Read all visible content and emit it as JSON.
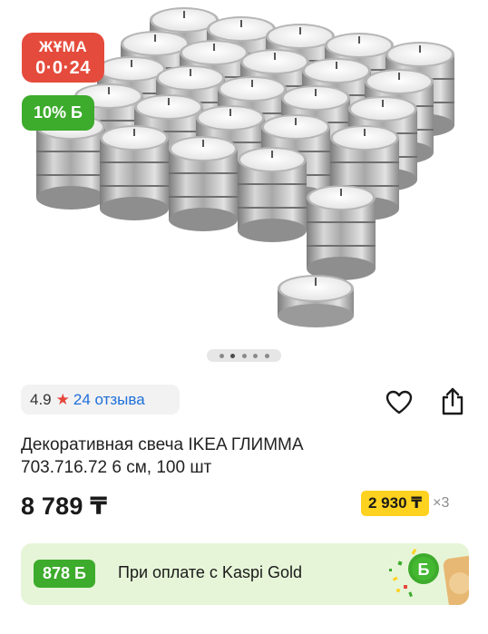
{
  "promo": {
    "friday_title": "ЖҰМА",
    "friday_timer": "0·0·24",
    "bonus_percent": "10% Б"
  },
  "gallery": {
    "current_index": 1,
    "total": 5
  },
  "rating": {
    "score": "4.9",
    "star": "★",
    "reviews": "24 отзыва"
  },
  "product": {
    "title_line1": "Декоративная свеча IKEA ГЛИММА",
    "title_line2": "703.716.72 6 см, 100 шт",
    "price": "8 789 ₸",
    "installment_amount": "2 930 ₸",
    "installment_multiplier": "×3"
  },
  "kaspi_gold": {
    "bonus": "878 Б",
    "text": "При оплате с Kaspi Gold"
  },
  "colors": {
    "friday_badge": "#e54b3c",
    "bonus_green": "#3dab2c",
    "installment_yellow": "#ffd21f",
    "reviews_link": "#1e6fd9",
    "banner_bg": "#e6f5d8"
  },
  "icons": {
    "favorite": "heart-outline-icon",
    "share": "share-icon",
    "rating": "star-icon",
    "banner_art": "bonus-coin-icon"
  }
}
